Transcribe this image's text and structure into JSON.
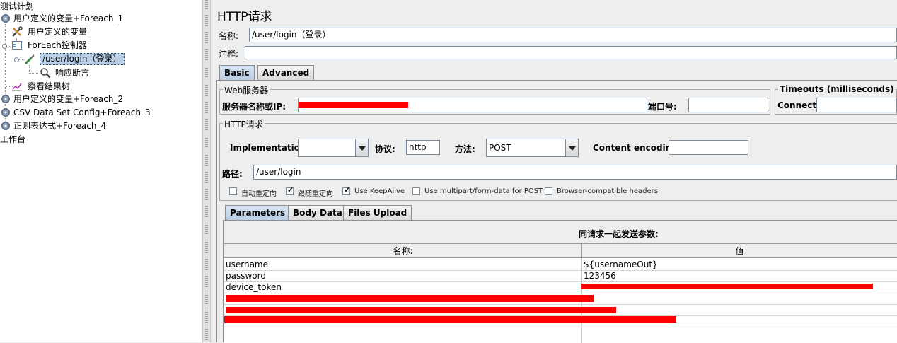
{
  "tree": {
    "root": "测试计划",
    "items": [
      {
        "label": "用户定义的变量+Foreach_1"
      },
      {
        "label": "用户定义的变量"
      },
      {
        "label": "ForEach控制器"
      },
      {
        "label": "/user/login（登录）"
      },
      {
        "label": "响应断言"
      },
      {
        "label": "察看结果树"
      },
      {
        "label": "用户定义的变量+Foreach_2"
      },
      {
        "label": "CSV Data Set Config+Foreach_3"
      },
      {
        "label": "正则表达式+Foreach_4"
      }
    ],
    "workbench": "工作台"
  },
  "main": {
    "title": "HTTP请求",
    "name_label": "名称:",
    "name_value": "/user/login（登录）",
    "comment_label": "注释:",
    "tabs": [
      "Basic",
      "Advanced"
    ],
    "web_server": {
      "group_title": "Web服务器",
      "server_label": "服务器名称或IP:",
      "port_label": "端口号:"
    },
    "timeouts": {
      "group_title": "Timeouts (milliseconds)",
      "connect_label": "Connect:"
    },
    "http": {
      "group_title": "HTTP请求",
      "implementation_label": "Implementation:",
      "implementation_value": "",
      "protocol_label": "协议:",
      "protocol_value": "http",
      "method_label": "方法:",
      "method_value": "POST",
      "encoding_label": "Content encoding:",
      "encoding_value": "",
      "path_label": "路径:",
      "path_value": "/user/login"
    },
    "checkboxes": [
      {
        "label": "自动重定向",
        "checked": false
      },
      {
        "label": "跟随重定向",
        "checked": true
      },
      {
        "label": "Use KeepAlive",
        "checked": true
      },
      {
        "label": "Use multipart/form-data for POST",
        "checked": false
      },
      {
        "label": "Browser-compatible headers",
        "checked": false
      }
    ],
    "param_tabs": [
      "Parameters",
      "Body Data",
      "Files Upload"
    ],
    "params_title": "同请求一起发送参数:",
    "columns": [
      "名称:",
      "值"
    ],
    "rows": [
      {
        "name": "username",
        "value": "${usernameOut}"
      },
      {
        "name": "password",
        "value": "123456"
      },
      {
        "name": "device_token",
        "value": ""
      }
    ]
  }
}
